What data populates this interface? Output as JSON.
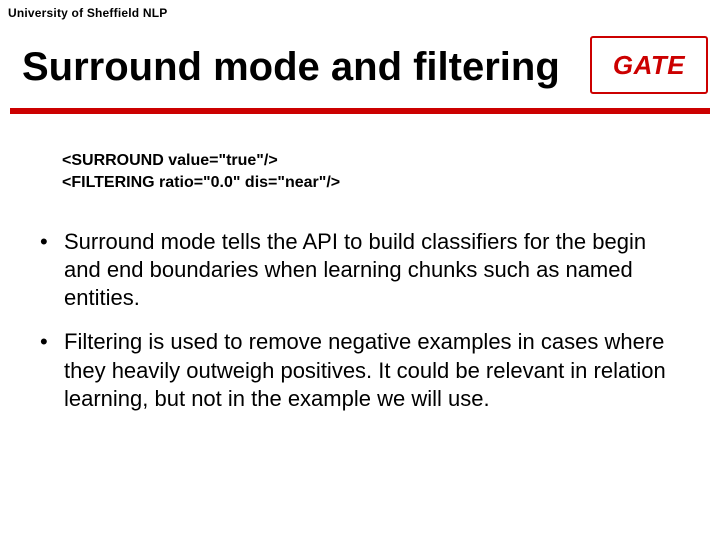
{
  "header": {
    "affiliation": "University of Sheffield NLP"
  },
  "title": "Surround mode and filtering",
  "logo": {
    "text": "GATE"
  },
  "code": {
    "line1": "<SURROUND value=\"true\"/>",
    "line2": "<FILTERING ratio=\"0.0\" dis=\"near\"/>"
  },
  "bullets": [
    "Surround mode tells the API to build classifiers for the begin and end boundaries when learning chunks such as named entities.",
    "Filtering is used to remove negative examples in cases where they heavily outweigh positives. It could be relevant in relation learning, but not in the example we will use."
  ],
  "colors": {
    "accent": "#cc0000"
  }
}
